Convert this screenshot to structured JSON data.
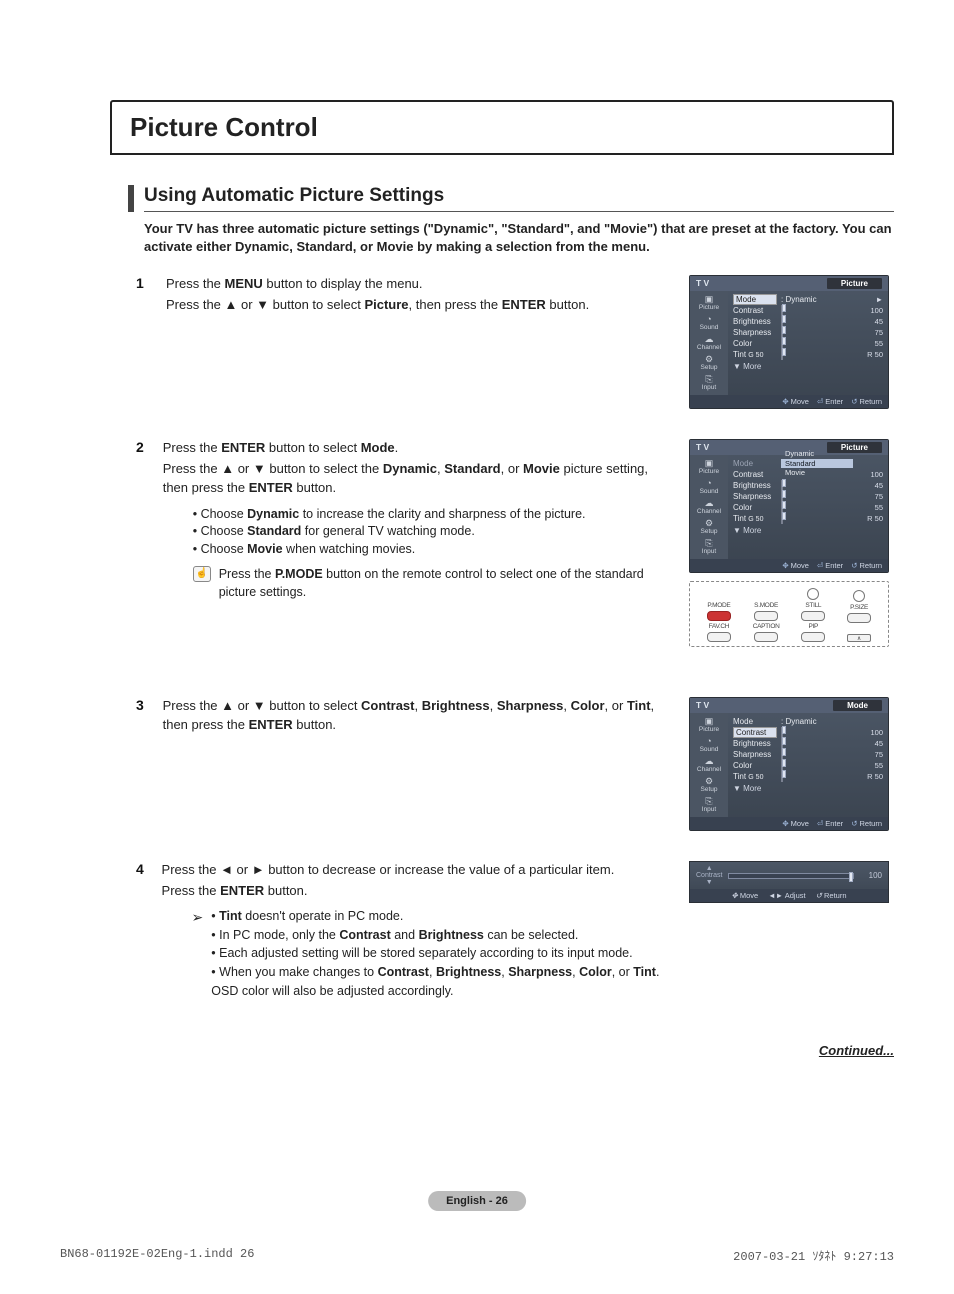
{
  "title": "Picture Control",
  "section_heading": "Using Automatic Picture Settings",
  "intro": "Your TV has three automatic picture settings (\"Dynamic\", \"Standard\", and \"Movie\") that are preset at the factory. You can activate either Dynamic, Standard, or Movie by making a selection from the menu.",
  "steps": {
    "1": {
      "p1a": "Press the ",
      "p1b": "MENU",
      "p1c": " button to display the menu.",
      "p2a": "Press the ▲ or ▼ button to select ",
      "p2b": "Picture",
      "p2c": ", then press the ",
      "p2d": "ENTER",
      "p2e": " button."
    },
    "2": {
      "p1a": "Press the ",
      "p1b": "ENTER",
      "p1c": " button to select ",
      "p1d": "Mode",
      "p1e": ".",
      "p2a": "Press the ▲ or ▼ button to select the ",
      "p2b": "Dynamic",
      "p2c": ", ",
      "p2d": "Standard",
      "p2e": ", or ",
      "p2f": "Movie",
      "p2g": " picture setting, then press the ",
      "p2h": "ENTER",
      "p2i": " button.",
      "b1a": "Choose ",
      "b1b": "Dynamic",
      "b1c": " to increase the clarity and sharpness of the picture.",
      "b2a": "Choose ",
      "b2b": "Standard",
      "b2c": " for general TV watching mode.",
      "b3a": "Choose ",
      "b3b": "Movie",
      "b3c": " when watching movies.",
      "n1a": "Press the ",
      "n1b": "P.MODE",
      "n1c": " button on the remote control to select one of the standard picture settings."
    },
    "3": {
      "p1a": "Press the ▲ or ▼ button to select ",
      "p1b": "Contrast",
      "p1c": ", ",
      "p1d": "Brightness",
      "p1e": ", ",
      "p1f": "Sharpness",
      "p1g": ", ",
      "p1h": "Color",
      "p1i": ", or ",
      "p1j": "Tint",
      "p1k": ", then press the ",
      "p1l": "ENTER",
      "p1m": " button."
    },
    "4": {
      "p1": "Press the ◄ or ► button to decrease or increase the value of a particular item.",
      "p2a": "Press the ",
      "p2b": "ENTER",
      "p2c": " button.",
      "a1a": "Tint",
      "a1b": " doesn't operate in PC mode.",
      "a2a": "In PC mode, only the ",
      "a2b": "Contrast",
      "a2c": " and ",
      "a2d": "Brightness",
      "a2e": " can be selected.",
      "a3": "Each adjusted setting will be stored separately according to its input mode.",
      "a4a": "When you make changes to ",
      "a4b": "Contrast",
      "a4c": ", ",
      "a4d": "Brightness",
      "a4e": ", ",
      "a4f": "Sharpness",
      "a4g": ", ",
      "a4h": "Color",
      "a4i": ", or ",
      "a4j": "Tint",
      "a4k": ". OSD color will also be adjusted accordingly."
    }
  },
  "continued": "Continued...",
  "footer": {
    "page_label": "English - 26",
    "left": "BN68-01192E-02Eng-1.indd    26",
    "right": "2007-03-21   ｿﾀﾈﾄ 9:27:13"
  },
  "osd_common": {
    "tv": "T V",
    "side": {
      "picture": "Picture",
      "sound": "Sound",
      "channel": "Channel",
      "setup": "Setup",
      "input": "Input"
    },
    "rows": {
      "mode": "Mode",
      "contrast": "Contrast",
      "brightness": "Brightness",
      "sharpness": "Sharpness",
      "color": "Color",
      "tint": "Tint"
    },
    "tint_left": "G 50",
    "tint_right": "R 50",
    "more": "▼ More",
    "foot": {
      "move": "Move",
      "enter": "Enter",
      "return": "Return",
      "adjust": "Adjust"
    },
    "dynamic": ": Dynamic",
    "vals": {
      "contrast": "100",
      "brightness": "45",
      "sharpness": "75",
      "color": "55"
    },
    "tab_picture": "Picture",
    "tab_mode": "Mode"
  },
  "osd2_dropdown": {
    "dynamic": "Dynamic",
    "standard": "Standard",
    "movie": "Movie"
  },
  "slider_panel": {
    "label": "Contrast",
    "value": "100"
  },
  "remote": {
    "pmode": "P.MODE",
    "smode": "S.MODE",
    "still": "STILL",
    "psize": "P.SIZE",
    "favch": "FAV.CH",
    "caption": "CAPTION",
    "pip": "PIP"
  }
}
